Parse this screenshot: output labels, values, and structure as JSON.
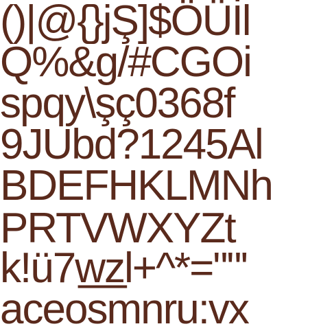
{
  "glyph_sheet": {
    "text_color": "#5a2a1c",
    "background": "#ffffff",
    "rows": [
      "()|@{}jŞ]$ÖÜİl",
      "Q%&g/#CGOi",
      "spqy\\şç0368f",
      "9JUbd?1245Al",
      "BDEFHKLMNh",
      "PRTVWXYZt",
      "k!ü7w̲z̲l+^*=\"\"'",
      "aceosmnru:vx"
    ]
  }
}
